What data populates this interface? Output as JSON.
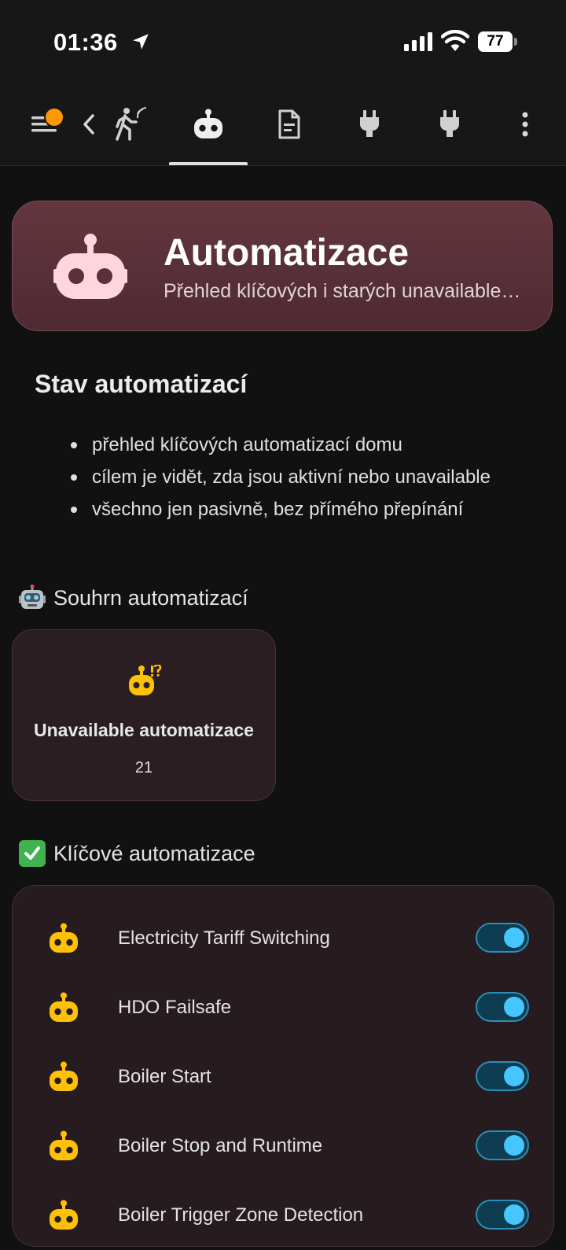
{
  "status_bar": {
    "time": "01:36",
    "battery": "77"
  },
  "hero": {
    "title": "Automatizace",
    "subtitle": "Přehled klíčových i starých unavailable automatizací"
  },
  "markdown": {
    "title": "Stav automatizací",
    "items": [
      "přehled klíčových automatizací domu",
      "cílem je vidět, zda jsou aktivní nebo unavailable",
      "všechno jen pasivně, bez přímého přepínání"
    ]
  },
  "summary": {
    "heading": "Souhrn automatizací",
    "tile": {
      "name": "Unavailable automatizace",
      "value": "21"
    }
  },
  "key": {
    "heading": "Klíčové automatizace",
    "rows": [
      {
        "label": "Electricity Tariff Switching",
        "on": true
      },
      {
        "label": "HDO Failsafe",
        "on": true
      },
      {
        "label": "Boiler Start",
        "on": true
      },
      {
        "label": "Boiler Stop and Runtime",
        "on": true
      },
      {
        "label": "Boiler Trigger Zone Detection",
        "on": true
      }
    ]
  },
  "colors": {
    "accent": "#45c6ff",
    "robot_icon": "#ffc107",
    "hero_bg": "#5a303a",
    "badge": "#ff9800"
  },
  "icons": {
    "toolbar": [
      "menu-icon",
      "back-icon",
      "person-walking-icon",
      "robot-icon",
      "document-icon",
      "plug-icon",
      "plug-icon",
      "more-vertical-icon"
    ]
  }
}
